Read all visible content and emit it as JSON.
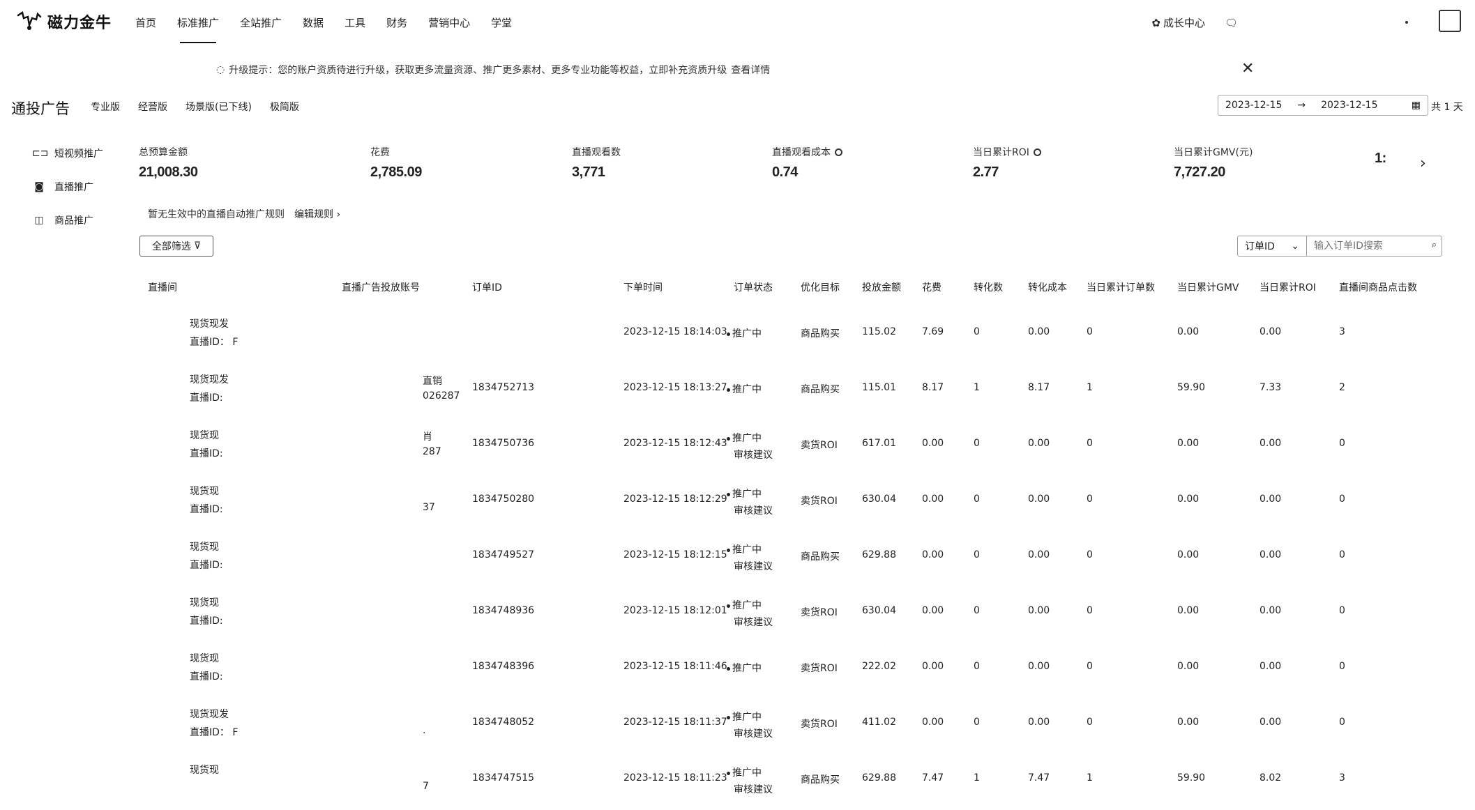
{
  "app": {
    "logo_text": "磁力金牛"
  },
  "nav": {
    "items": [
      "首页",
      "标准推广",
      "全站推广",
      "数据",
      "工具",
      "财务",
      "营销中心",
      "学堂"
    ],
    "active_index": 1
  },
  "top_right": {
    "growth_center": "成长中心"
  },
  "notice": {
    "text": "升级提示：您的账户资质待进行升级，获取更多流量资源、推广更多素材、更多专业功能等权益，立即补充资质升级",
    "link": "查看详情"
  },
  "header": {
    "title": "通投广告",
    "versions": [
      "专业版",
      "经营版",
      "场景版(已下线)",
      "极简版"
    ]
  },
  "date": {
    "start": "2023-12-15",
    "arrow": "→",
    "end": "2023-12-15",
    "total": "共 1 天"
  },
  "sidebar": {
    "items": [
      {
        "label": "短视频推广",
        "icon": "video-icon"
      },
      {
        "label": "直播推广",
        "icon": "live-icon"
      },
      {
        "label": "商品推广",
        "icon": "product-icon"
      }
    ]
  },
  "metrics": [
    {
      "label": "总预算金额",
      "value": "21,008.30",
      "info": false
    },
    {
      "label": "花费",
      "value": "2,785.09",
      "info": false
    },
    {
      "label": "直播观看数",
      "value": "3,771",
      "info": false
    },
    {
      "label": "直播观看成本",
      "value": "0.74",
      "info": true
    },
    {
      "label": "当日累计ROI",
      "value": "2.77",
      "info": true
    },
    {
      "label": "当日累计GMV(元)",
      "value": "7,727.20",
      "info": false
    },
    {
      "label": "",
      "value": "1:",
      "info": false
    }
  ],
  "rule": {
    "text": "暂无生效中的直播自动推广规则",
    "link": "编辑规则"
  },
  "filter": {
    "label": "全部筛选"
  },
  "search": {
    "select_value": "订单ID",
    "placeholder": "输入订单ID搜索"
  },
  "table": {
    "headers": [
      "直播间",
      "直播广告投放账号",
      "订单ID",
      "下单时间",
      "订单状态",
      "优化目标",
      "投放金额",
      "花费",
      "转化数",
      "转化成本",
      "当日累计订单数",
      "当日累计GMV",
      "当日累计ROI",
      "直播间商品点击数"
    ],
    "rows": [
      {
        "room": "现货现发",
        "room_id": "直播ID：  F",
        "acct1": "",
        "acct2": "",
        "order_id": "",
        "time": "2023-12-15 18:14:03",
        "status1": "推广中",
        "status2": "",
        "goal": "商品购买",
        "amount": "115.02",
        "spend": "7.69",
        "conv": "0",
        "conv_cost": "0.00",
        "orders": "0",
        "gmv": "0.00",
        "roi": "0.00",
        "clicks": "3"
      },
      {
        "room": "现货现发",
        "room_id": "直播ID:",
        "acct1": "直销",
        "acct2": "026287",
        "order_id": "1834752713",
        "time": "2023-12-15 18:13:27",
        "status1": "推广中",
        "status2": "",
        "goal": "商品购买",
        "amount": "115.01",
        "spend": "8.17",
        "conv": "1",
        "conv_cost": "8.17",
        "orders": "1",
        "gmv": "59.90",
        "roi": "7.33",
        "clicks": "2"
      },
      {
        "room": "现货现",
        "room_id": "直播ID:",
        "acct1": "肖",
        "acct2": "287",
        "order_id": "1834750736",
        "time": "2023-12-15 18:12:43",
        "status1": "推广中",
        "status2": "审核建议",
        "goal": "卖货ROI",
        "amount": "617.01",
        "spend": "0.00",
        "conv": "0",
        "conv_cost": "0.00",
        "orders": "0",
        "gmv": "0.00",
        "roi": "0.00",
        "clicks": "0"
      },
      {
        "room": "现货现",
        "room_id": "直播ID:",
        "acct1": "",
        "acct2": "37",
        "order_id": "1834750280",
        "time": "2023-12-15 18:12:29",
        "status1": "推广中",
        "status2": "审核建议",
        "goal": "卖货ROI",
        "amount": "630.04",
        "spend": "0.00",
        "conv": "0",
        "conv_cost": "0.00",
        "orders": "0",
        "gmv": "0.00",
        "roi": "0.00",
        "clicks": "0"
      },
      {
        "room": "现货现",
        "room_id": "直播ID:",
        "acct1": "",
        "acct2": "",
        "order_id": "1834749527",
        "time": "2023-12-15 18:12:15",
        "status1": "推广中",
        "status2": "审核建议",
        "goal": "商品购买",
        "amount": "629.88",
        "spend": "0.00",
        "conv": "0",
        "conv_cost": "0.00",
        "orders": "0",
        "gmv": "0.00",
        "roi": "0.00",
        "clicks": "0"
      },
      {
        "room": "现货现",
        "room_id": "直播ID:",
        "acct1": "",
        "acct2": "",
        "order_id": "1834748936",
        "time": "2023-12-15 18:12:01",
        "status1": "推广中",
        "status2": "审核建议",
        "goal": "卖货ROI",
        "amount": "630.04",
        "spend": "0.00",
        "conv": "0",
        "conv_cost": "0.00",
        "orders": "0",
        "gmv": "0.00",
        "roi": "0.00",
        "clicks": "0"
      },
      {
        "room": "现货现",
        "room_id": "直播ID:",
        "acct1": "",
        "acct2": "",
        "order_id": "1834748396",
        "time": "2023-12-15 18:11:46",
        "status1": "推广中",
        "status2": "",
        "goal": "卖货ROI",
        "amount": "222.02",
        "spend": "0.00",
        "conv": "0",
        "conv_cost": "0.00",
        "orders": "0",
        "gmv": "0.00",
        "roi": "0.00",
        "clicks": "0"
      },
      {
        "room": "现货现发",
        "room_id": "直播ID：  F",
        "acct1": "",
        "acct2": ".",
        "order_id": "1834748052",
        "time": "2023-12-15 18:11:37",
        "status1": "推广中",
        "status2": "审核建议",
        "goal": "卖货ROI",
        "amount": "411.02",
        "spend": "0.00",
        "conv": "0",
        "conv_cost": "0.00",
        "orders": "0",
        "gmv": "0.00",
        "roi": "0.00",
        "clicks": "0"
      },
      {
        "room": "现货现",
        "room_id": "",
        "acct1": "",
        "acct2": "7",
        "order_id": "1834747515",
        "time": "2023-12-15 18:11:23",
        "status1": "推广中",
        "status2": "审核建议",
        "goal": "商品购买",
        "amount": "629.88",
        "spend": "7.47",
        "conv": "1",
        "conv_cost": "7.47",
        "orders": "1",
        "gmv": "59.90",
        "roi": "8.02",
        "clicks": "3"
      }
    ]
  }
}
